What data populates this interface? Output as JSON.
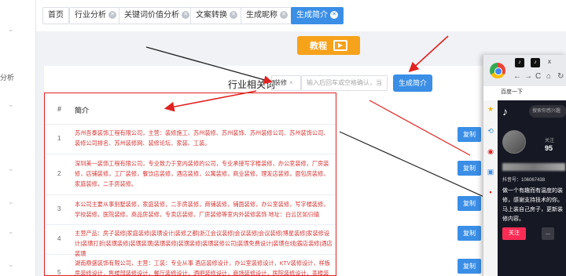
{
  "sidebar": {
    "label": "分析"
  },
  "tabs": [
    {
      "label": "首页",
      "closable": false,
      "active": false
    },
    {
      "label": "行业分析",
      "closable": true,
      "active": false
    },
    {
      "label": "关键词价值分析",
      "closable": true,
      "active": false
    },
    {
      "label": "文案转换",
      "closable": true,
      "active": false
    },
    {
      "label": "生成昵称",
      "closable": true,
      "active": false
    },
    {
      "label": "生成简介",
      "closable": true,
      "active": true
    }
  ],
  "tutorial_label": "教程",
  "form": {
    "keyword_label": "行业相关词",
    "tag_value": "装修",
    "input_placeholder": "输入后回车或空格确认，当",
    "generate_button": "生成简介"
  },
  "table": {
    "col_index": "#",
    "col_intro": "简介",
    "copy_label": "复制",
    "rows": [
      {
        "num": "1",
        "text": "苏州吾泰装饰工程有限公司，主营：装修施工、苏州装修、苏州装饰、苏州装修公司、苏州装饰公司、装修公司排名、苏州装修网、装修论坛、家装、工装。"
      },
      {
        "num": "2",
        "text": "深圳美一装饰工程有限公司，专业致力于室内装修的公司，专业承接写字楼装修，办公室装修，厂房装修，店铺装修，工厂装修，餐饮店装修，酒店装修，公寓装修，商业装修，理发店装修，面包房装修，家庭装修，二手房装修。"
      },
      {
        "num": "3",
        "text": "本公司主要从事别墅装修，家庭装修，二手房装修，商铺装修，铺面装修，办公室装修，写字楼装修，学校装修，医院装修，商品房装修，专卖店装修，厂房装修等室内外装修装饰 地址：白云区如归镇"
      },
      {
        "num": "4",
        "text": "主营产品：房子装修|家庭装修|装璜设计|装修之都|浙江会议装修|会议装修|会议装修|博星装修|家装修设计|装璜打折|装璜装修|装璜装璜|装璜装修|装璜装修|装璜装修公司|装璜免费设计|装璜在线|霸店装修|酒店装璜"
      },
      {
        "num": "5",
        "text": "湖南鼎盛装饰有限公司，主营：工装：专业从事 酒店装修设计，办公室装修设计，KTV装修设计，样板房装修设计，售楼部装修设计，餐厅装修设计，酒吧装修设计，商场装修设计，医院装修设计，茶楼装修设计，网吧装修设计"
      }
    ]
  },
  "browser": {
    "tab_x": "x",
    "nav_icons": [
      "←",
      "→",
      "C",
      "⌂",
      "↻"
    ],
    "bookmark": "百度一下",
    "search_placeholder": "搜索你感兴趣",
    "follow_label": "关注",
    "follow_count": "95",
    "douyin_id": "抖音号：106067438",
    "bio": "做一个有趣而有温度的装修，感谢支持技术的你。马上装自己房子，更新装修内容。",
    "follow_button": "关注",
    "more_button": "..."
  },
  "colors": {
    "primary": "#3a8ee6",
    "highlight_red": "#e02222",
    "tutorial_orange": "#f7a21b",
    "douyin_red": "#fe2c55"
  }
}
